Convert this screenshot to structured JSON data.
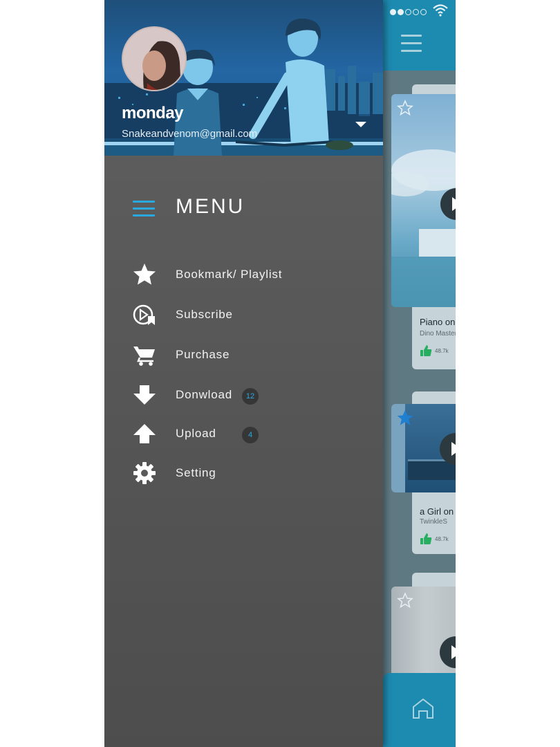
{
  "status_bar": {
    "signal": "signal-dots",
    "wifi": "wifi-icon"
  },
  "user": {
    "name": "monday",
    "email": "Snakeandvenom@gmail.com"
  },
  "menu": {
    "title": "MENU",
    "items": [
      {
        "label": "Bookmark/ Playlist",
        "icon": "star-icon"
      },
      {
        "label": "Subscribe",
        "icon": "subscribe-icon"
      },
      {
        "label": "Purchase",
        "icon": "cart-icon"
      },
      {
        "label": "Donwload",
        "icon": "download-icon",
        "badge": "12"
      },
      {
        "label": "Upload",
        "icon": "upload-icon",
        "badge": "4"
      },
      {
        "label": "Setting",
        "icon": "gear-icon"
      }
    ]
  },
  "feed": {
    "cards": [
      {
        "title": "Piano on",
        "artist": "Dino Master",
        "likes": "48.7k",
        "starred": false
      },
      {
        "title": "a Girl on",
        "artist": "TwinkleS",
        "likes": "48.7k",
        "starred": true
      },
      {
        "starred": false
      }
    ]
  },
  "colors": {
    "accent": "#29a9e0",
    "topbar": "#1d8ab0",
    "drawer": "#575757",
    "like": "#27ae60"
  }
}
